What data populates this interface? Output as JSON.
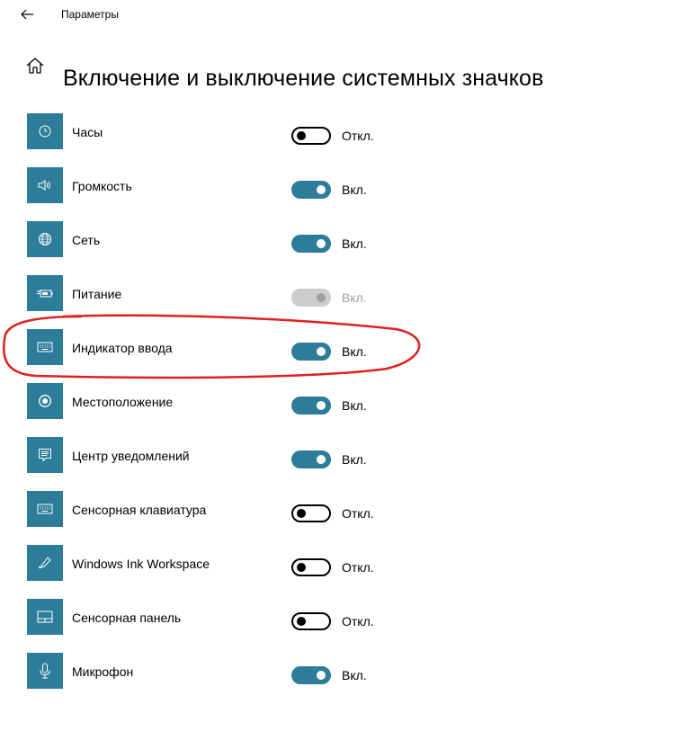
{
  "window": {
    "title": "Параметры"
  },
  "page": {
    "title": "Включение и выключение системных значков"
  },
  "colors": {
    "accent": "#2d7d9a",
    "toggle_disabled": "#cccccc",
    "text_disabled": "#a0a0a0",
    "annotation": "#e02020"
  },
  "items": [
    {
      "label": "Часы",
      "state": "off",
      "state_label": "Откл.",
      "icon": "clock-icon"
    },
    {
      "label": "Громкость",
      "state": "on",
      "state_label": "Вкл.",
      "icon": "volume-icon"
    },
    {
      "label": "Сеть",
      "state": "on",
      "state_label": "Вкл.",
      "icon": "globe-icon"
    },
    {
      "label": "Питание",
      "state": "disabled",
      "state_label": "Вкл.",
      "icon": "battery-plug-icon"
    },
    {
      "label": "Индикатор ввода",
      "state": "on",
      "state_label": "Вкл.",
      "icon": "keyboard-icon"
    },
    {
      "label": "Местоположение",
      "state": "on",
      "state_label": "Вкл.",
      "icon": "location-icon"
    },
    {
      "label": "Центр уведомлений",
      "state": "on",
      "state_label": "Вкл.",
      "icon": "notification-icon"
    },
    {
      "label": "Сенсорная клавиатура",
      "state": "off",
      "state_label": "Откл.",
      "icon": "keyboard-icon"
    },
    {
      "label": "Windows Ink Workspace",
      "state": "off",
      "state_label": "Откл.",
      "icon": "pen-icon"
    },
    {
      "label": "Сенсорная панель",
      "state": "off",
      "state_label": "Откл.",
      "icon": "touchpad-icon"
    },
    {
      "label": "Микрофон",
      "state": "on",
      "state_label": "Вкл.",
      "icon": "microphone-icon"
    }
  ]
}
